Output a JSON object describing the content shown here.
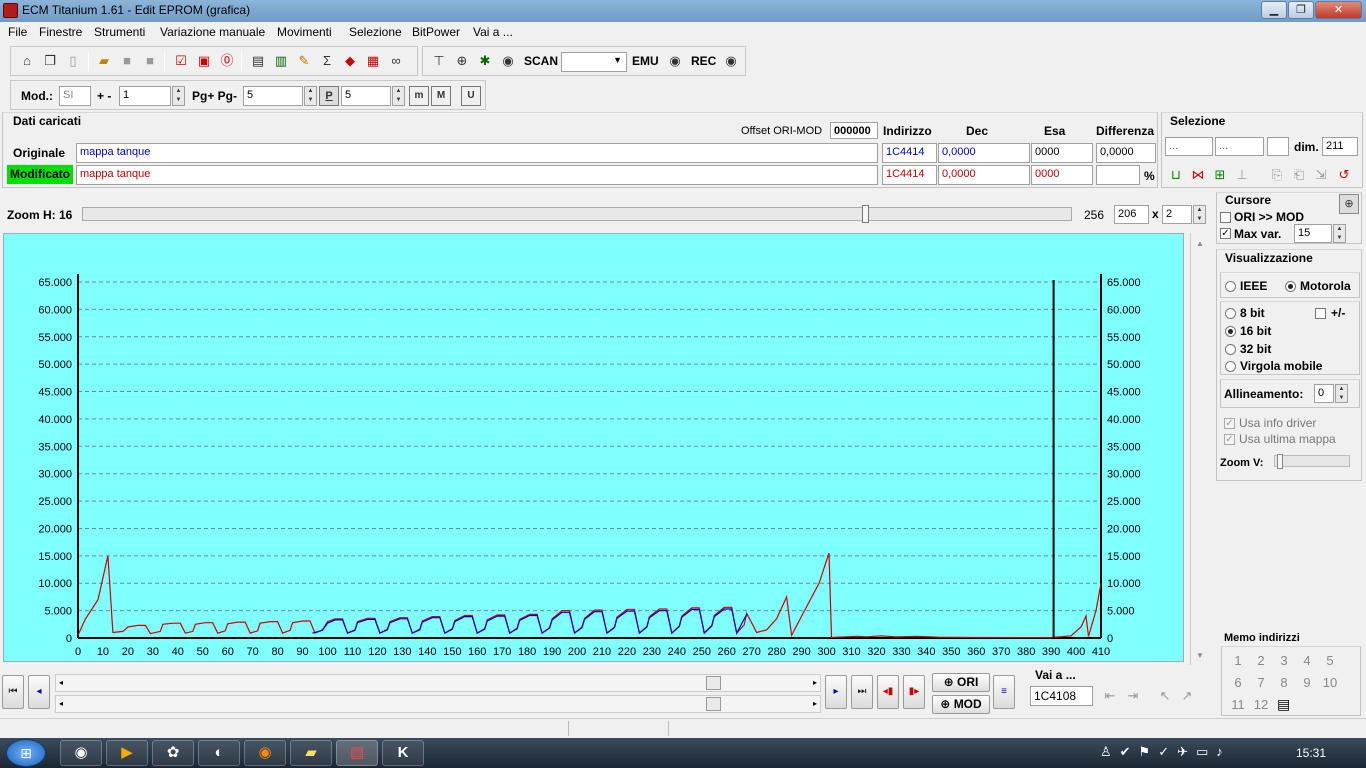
{
  "window": {
    "title": "ECM Titanium 1.61 - Edit EPROM (grafica)",
    "min": "▁",
    "max": "❐",
    "close": "✕"
  },
  "menu": [
    "File",
    "Finestre",
    "Strumenti",
    "Variazione manuale",
    "Movimenti",
    "Selezione",
    "BitPower",
    "Vai a ..."
  ],
  "toolbar2": {
    "scan": "SCAN",
    "emu": "EMU",
    "rec": "REC"
  },
  "toolbar3": {
    "mod_label": "Mod.:",
    "mod_value": "SI",
    "plusminus": "+ -",
    "step_value": "1",
    "pg_label": "Pg+ Pg-",
    "pg_value": "5",
    "p_value": "5",
    "p_btn": "P",
    "m1": "m",
    "m2": "M",
    "u": "U"
  },
  "dati": {
    "title": "Dati caricati",
    "offset_label": "Offset ORI-MOD",
    "offset_value": "000000",
    "col_indirizzo": "Indirizzo",
    "col_dec": "Dec",
    "col_esa": "Esa",
    "col_diff": "Differenza",
    "orig_label": "Originale",
    "orig_name": "mappa tanque",
    "orig_addr": "1C4414",
    "orig_dec": "0,0000",
    "orig_esa": "0000",
    "orig_diff": "0,0000",
    "mod_label": "Modificato",
    "mod_name": "mappa tanque",
    "mod_addr": "1C4414",
    "mod_dec": "0,0000",
    "mod_esa": "0000",
    "pct": "%"
  },
  "selezione": {
    "title": "Selezione",
    "f1": "...",
    "f2": "...",
    "f3": "",
    "dim_label": "dim.",
    "dim_value": "211"
  },
  "zoom": {
    "label": "Zoom H: 16",
    "max": "256",
    "value": "206",
    "x": "x",
    "mult": "2",
    "slider_pos": 0.8
  },
  "cursore": {
    "title": "Cursore",
    "ori_mod": "ORI >> MOD",
    "maxvar_label": "Max var.",
    "maxvar_value": "15"
  },
  "vis": {
    "title": "Visualizzazione",
    "ieee": "IEEE",
    "motorola": "Motorola",
    "b8": "8 bit",
    "pm": "+/-",
    "b16": "16 bit",
    "b32": "32 bit",
    "virgola": "Virgola mobile",
    "allin_label": "Allineamento:",
    "allin_value": "0",
    "info_driver": "Usa info driver",
    "ultima_mappa": "Usa ultima mappa",
    "zoomv": "Zoom V:"
  },
  "memo": {
    "title": "Memo indirizzi",
    "items": [
      "1",
      "2",
      "3",
      "4",
      "5",
      "6",
      "7",
      "8",
      "9",
      "10",
      "11",
      "12"
    ]
  },
  "vaia": {
    "title": "Vai a ...",
    "value": "1C4108"
  },
  "bottom": {
    "ori": "ORI",
    "mod": "MOD"
  },
  "taskbar": {
    "time": "15:31"
  },
  "colors": {
    "chart_bg": "#80ffff",
    "orig_line": "#d00000",
    "mod_line": "#0000c0",
    "modificato_bg": "#00e000"
  },
  "chart_data": {
    "type": "line",
    "xlim": [
      0,
      410
    ],
    "ylim": [
      0,
      65000
    ],
    "x_ticks": [
      0,
      10,
      20,
      30,
      40,
      50,
      60,
      70,
      80,
      90,
      100,
      110,
      120,
      130,
      140,
      150,
      160,
      170,
      180,
      190,
      200,
      210,
      220,
      230,
      240,
      250,
      260,
      270,
      280,
      290,
      300,
      310,
      320,
      330,
      340,
      350,
      360,
      370,
      380,
      390,
      400,
      410
    ],
    "y_ticks": [
      "0",
      "5.000",
      "10.000",
      "15.000",
      "20.000",
      "25.000",
      "30.000",
      "35.000",
      "40.000",
      "45.000",
      "50.000",
      "55.000",
      "60.000",
      "65.000"
    ],
    "y_tick_values": [
      0,
      5000,
      10000,
      15000,
      20000,
      25000,
      30000,
      35000,
      40000,
      45000,
      50000,
      55000,
      60000,
      65000
    ],
    "grid": true,
    "cursor_x": 391,
    "series": [
      {
        "color": "#d00000",
        "points": [
          [
            0,
            500
          ],
          [
            3,
            3500
          ],
          [
            8,
            7000
          ],
          [
            12,
            15000
          ],
          [
            14,
            1000
          ],
          [
            18,
            1200
          ],
          [
            20,
            2000
          ],
          [
            24,
            2300
          ],
          [
            27,
            2300
          ],
          [
            29,
            800
          ],
          [
            33,
            1200
          ],
          [
            34,
            2500
          ],
          [
            38,
            2700
          ],
          [
            41,
            2700
          ],
          [
            43,
            900
          ],
          [
            46,
            1200
          ],
          [
            47,
            2500
          ],
          [
            51,
            2800
          ],
          [
            54,
            2800
          ],
          [
            56,
            900
          ],
          [
            59,
            1300
          ],
          [
            60,
            2600
          ],
          [
            64,
            2900
          ],
          [
            67,
            2900
          ],
          [
            69,
            900
          ],
          [
            72,
            1300
          ],
          [
            73,
            2700
          ],
          [
            77,
            3000
          ],
          [
            80,
            3000
          ],
          [
            82,
            900
          ],
          [
            85,
            1400
          ],
          [
            86,
            2800
          ],
          [
            90,
            3100
          ],
          [
            93,
            3100
          ],
          [
            95,
            900
          ],
          [
            98,
            1500
          ],
          [
            100,
            3000
          ],
          [
            103,
            3500
          ],
          [
            106,
            3500
          ],
          [
            108,
            900
          ],
          [
            111,
            1500
          ],
          [
            112,
            3000
          ],
          [
            116,
            3600
          ],
          [
            119,
            3600
          ],
          [
            121,
            900
          ],
          [
            124,
            1600
          ],
          [
            125,
            3000
          ],
          [
            129,
            3700
          ],
          [
            132,
            3700
          ],
          [
            134,
            900
          ],
          [
            137,
            1600
          ],
          [
            138,
            3100
          ],
          [
            142,
            3900
          ],
          [
            145,
            3900
          ],
          [
            147,
            900
          ],
          [
            150,
            1700
          ],
          [
            151,
            3200
          ],
          [
            155,
            4100
          ],
          [
            158,
            4100
          ],
          [
            160,
            900
          ],
          [
            163,
            1700
          ],
          [
            164,
            3300
          ],
          [
            168,
            4200
          ],
          [
            171,
            4200
          ],
          [
            173,
            900
          ],
          [
            176,
            1800
          ],
          [
            177,
            3400
          ],
          [
            181,
            4300
          ],
          [
            184,
            4300
          ],
          [
            186,
            900
          ],
          [
            189,
            1900
          ],
          [
            190,
            3500
          ],
          [
            194,
            5000
          ],
          [
            197,
            5000
          ],
          [
            199,
            900
          ],
          [
            202,
            2000
          ],
          [
            203,
            3600
          ],
          [
            207,
            5100
          ],
          [
            210,
            5100
          ],
          [
            212,
            900
          ],
          [
            215,
            2000
          ],
          [
            216,
            3800
          ],
          [
            220,
            5200
          ],
          [
            223,
            5200
          ],
          [
            225,
            900
          ],
          [
            228,
            2100
          ],
          [
            229,
            3900
          ],
          [
            233,
            5300
          ],
          [
            236,
            5300
          ],
          [
            238,
            900
          ],
          [
            241,
            2200
          ],
          [
            242,
            4000
          ],
          [
            246,
            5500
          ],
          [
            249,
            5500
          ],
          [
            251,
            900
          ],
          [
            254,
            2300
          ],
          [
            255,
            4100
          ],
          [
            259,
            5600
          ],
          [
            262,
            5600
          ],
          [
            264,
            900
          ],
          [
            267,
            2400
          ],
          [
            268,
            4500
          ],
          [
            272,
            1000
          ],
          [
            276,
            1500
          ],
          [
            280,
            3500
          ],
          [
            284,
            7500
          ],
          [
            286,
            500
          ],
          [
            290,
            4000
          ],
          [
            297,
            10000
          ],
          [
            301,
            15500
          ],
          [
            302,
            100
          ],
          [
            312,
            300
          ],
          [
            316,
            200
          ],
          [
            322,
            400
          ],
          [
            328,
            200
          ],
          [
            336,
            300
          ],
          [
            345,
            150
          ],
          [
            360,
            100
          ],
          [
            390,
            80
          ],
          [
            398,
            400
          ],
          [
            402,
            2000
          ],
          [
            404,
            4000
          ],
          [
            405,
            300
          ],
          [
            408,
            5000
          ],
          [
            410,
            10000
          ]
        ]
      },
      {
        "color": "#0000c0",
        "points": [
          [
            94,
            900
          ],
          [
            98,
            1400
          ],
          [
            100,
            2700
          ],
          [
            103,
            3300
          ],
          [
            106,
            3300
          ],
          [
            108,
            900
          ],
          [
            111,
            1400
          ],
          [
            112,
            2800
          ],
          [
            116,
            3400
          ],
          [
            119,
            3400
          ],
          [
            121,
            900
          ],
          [
            124,
            1500
          ],
          [
            125,
            2800
          ],
          [
            129,
            3500
          ],
          [
            132,
            3500
          ],
          [
            134,
            900
          ],
          [
            137,
            1500
          ],
          [
            138,
            2900
          ],
          [
            142,
            3700
          ],
          [
            145,
            3700
          ],
          [
            147,
            900
          ],
          [
            150,
            1600
          ],
          [
            151,
            3000
          ],
          [
            155,
            3900
          ],
          [
            158,
            3900
          ],
          [
            160,
            900
          ],
          [
            163,
            1600
          ],
          [
            164,
            3100
          ],
          [
            168,
            4000
          ],
          [
            171,
            4000
          ],
          [
            173,
            900
          ],
          [
            176,
            1700
          ],
          [
            177,
            3200
          ],
          [
            181,
            4100
          ],
          [
            184,
            4100
          ],
          [
            186,
            900
          ],
          [
            189,
            1800
          ],
          [
            190,
            3300
          ],
          [
            194,
            4700
          ],
          [
            197,
            4700
          ],
          [
            199,
            900
          ],
          [
            202,
            1900
          ],
          [
            203,
            3400
          ],
          [
            207,
            4800
          ],
          [
            210,
            4800
          ],
          [
            212,
            900
          ],
          [
            215,
            1900
          ],
          [
            216,
            3600
          ],
          [
            220,
            4900
          ],
          [
            223,
            4900
          ],
          [
            225,
            900
          ],
          [
            228,
            2000
          ],
          [
            229,
            3700
          ],
          [
            233,
            5000
          ],
          [
            236,
            5000
          ],
          [
            238,
            900
          ],
          [
            241,
            2100
          ],
          [
            242,
            3800
          ],
          [
            246,
            5200
          ],
          [
            249,
            5200
          ],
          [
            251,
            900
          ],
          [
            254,
            2200
          ],
          [
            255,
            3900
          ],
          [
            259,
            5300
          ],
          [
            262,
            5300
          ],
          [
            264,
            900
          ],
          [
            268,
            4300
          ]
        ]
      }
    ]
  }
}
